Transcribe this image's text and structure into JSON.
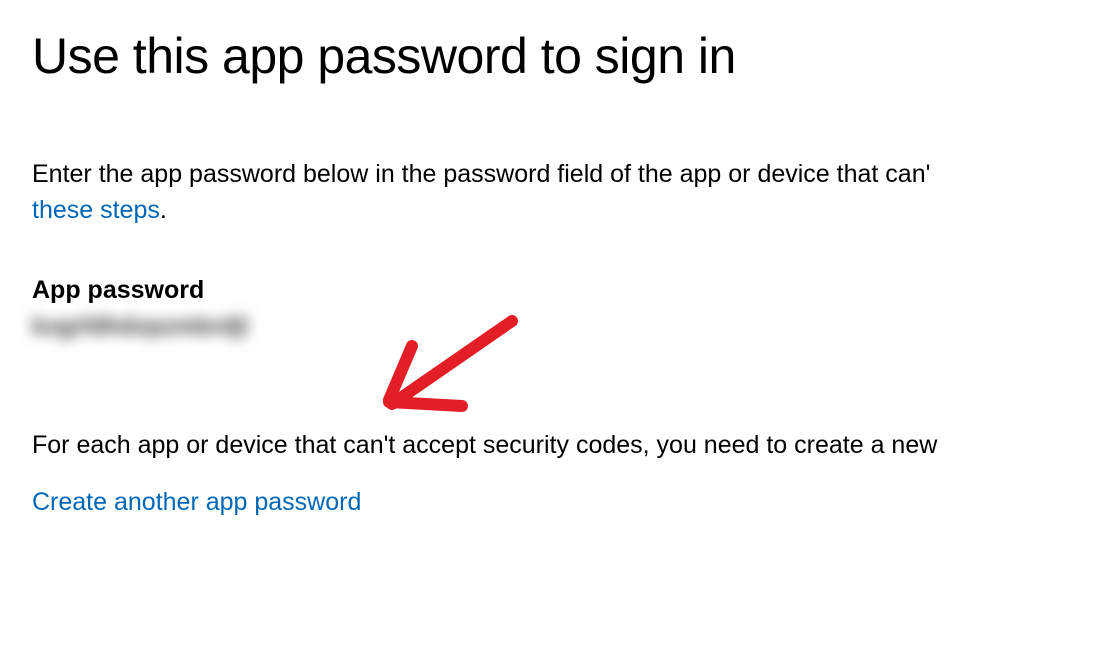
{
  "title": "Use this app password to sign in",
  "intro": {
    "text_before_link": "Enter the app password below in the password field of the app or device that can'",
    "link_text": "these steps",
    "period": "."
  },
  "section": {
    "label": "App password",
    "value": "kxgrfdhdxpzmbrdjl"
  },
  "followup": "For each app or device that can't accept security codes, you need to create a new",
  "create_link": "Create another app password",
  "annotation": {
    "arrow_color": "#e41e26"
  }
}
